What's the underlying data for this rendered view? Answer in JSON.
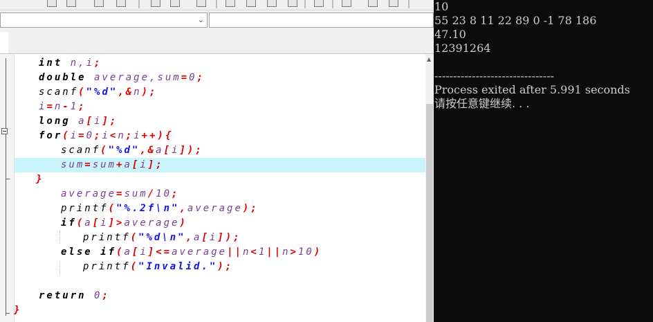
{
  "code_lines": [
    [
      {
        "t": "int",
        "c": "kw"
      },
      {
        "t": " n,i",
        "c": "id"
      },
      {
        "t": ";",
        "c": "op"
      }
    ],
    [
      {
        "t": "double",
        "c": "kw"
      },
      {
        "t": " average,sum",
        "c": "id"
      },
      {
        "t": "=",
        "c": "op"
      },
      {
        "t": "0",
        "c": "num"
      },
      {
        "t": ";",
        "c": "op"
      }
    ],
    [
      {
        "t": "scanf",
        "c": "fn"
      },
      {
        "t": "(",
        "c": "op"
      },
      {
        "t": "\"%d\"",
        "c": "str"
      },
      {
        "t": ",&",
        "c": "op"
      },
      {
        "t": "n",
        "c": "id"
      },
      {
        "t": ");",
        "c": "op"
      }
    ],
    [
      {
        "t": "i",
        "c": "id"
      },
      {
        "t": "=",
        "c": "op"
      },
      {
        "t": "n",
        "c": "id"
      },
      {
        "t": "-",
        "c": "op"
      },
      {
        "t": "1",
        "c": "num"
      },
      {
        "t": ";",
        "c": "op"
      }
    ],
    [
      {
        "t": "long",
        "c": "kw"
      },
      {
        "t": " a",
        "c": "id"
      },
      {
        "t": "[",
        "c": "op"
      },
      {
        "t": "i",
        "c": "id"
      },
      {
        "t": "];",
        "c": "op"
      }
    ],
    [
      {
        "t": "for",
        "c": "kw"
      },
      {
        "t": "(",
        "c": "op"
      },
      {
        "t": "i",
        "c": "id"
      },
      {
        "t": "=",
        "c": "op"
      },
      {
        "t": "0",
        "c": "num"
      },
      {
        "t": ";",
        "c": "op"
      },
      {
        "t": "i",
        "c": "id"
      },
      {
        "t": "<",
        "c": "op"
      },
      {
        "t": "n",
        "c": "id"
      },
      {
        "t": ";",
        "c": "op"
      },
      {
        "t": "i",
        "c": "id"
      },
      {
        "t": "++){",
        "c": "op"
      }
    ],
    [
      {
        "t": "scanf",
        "c": "fn"
      },
      {
        "t": "(",
        "c": "op"
      },
      {
        "t": "\"%d\"",
        "c": "str"
      },
      {
        "t": ",&",
        "c": "op"
      },
      {
        "t": "a",
        "c": "id"
      },
      {
        "t": "[",
        "c": "op"
      },
      {
        "t": "i",
        "c": "id"
      },
      {
        "t": "]);",
        "c": "op"
      }
    ],
    [
      {
        "t": "sum",
        "c": "id"
      },
      {
        "t": "=",
        "c": "op"
      },
      {
        "t": "sum",
        "c": "id"
      },
      {
        "t": "+",
        "c": "op"
      },
      {
        "t": "a",
        "c": "id"
      },
      {
        "t": "[",
        "c": "op"
      },
      {
        "t": "i",
        "c": "id"
      },
      {
        "t": "];",
        "c": "op"
      }
    ],
    [
      {
        "t": "}",
        "c": "op"
      }
    ],
    [
      {
        "t": "average",
        "c": "id"
      },
      {
        "t": "=",
        "c": "op"
      },
      {
        "t": "sum",
        "c": "id"
      },
      {
        "t": "/",
        "c": "op"
      },
      {
        "t": "10",
        "c": "num"
      },
      {
        "t": ";",
        "c": "op"
      }
    ],
    [
      {
        "t": "printf",
        "c": "fn"
      },
      {
        "t": "(",
        "c": "op"
      },
      {
        "t": "\"%.2f\\n\"",
        "c": "str"
      },
      {
        "t": ",",
        "c": "op"
      },
      {
        "t": "average",
        "c": "id"
      },
      {
        "t": ");",
        "c": "op"
      }
    ],
    [
      {
        "t": "if",
        "c": "kw"
      },
      {
        "t": "(",
        "c": "op"
      },
      {
        "t": "a",
        "c": "id"
      },
      {
        "t": "[",
        "c": "op"
      },
      {
        "t": "i",
        "c": "id"
      },
      {
        "t": "]>",
        "c": "op"
      },
      {
        "t": "average",
        "c": "id"
      },
      {
        "t": ")",
        "c": "op"
      }
    ],
    [
      {
        "t": "printf",
        "c": "fn"
      },
      {
        "t": "(",
        "c": "op"
      },
      {
        "t": "\"%d\\n\"",
        "c": "str"
      },
      {
        "t": ",",
        "c": "op"
      },
      {
        "t": "a",
        "c": "id"
      },
      {
        "t": "[",
        "c": "op"
      },
      {
        "t": "i",
        "c": "id"
      },
      {
        "t": "]);",
        "c": "op"
      }
    ],
    [
      {
        "t": "else if",
        "c": "kw"
      },
      {
        "t": "(",
        "c": "op"
      },
      {
        "t": "a",
        "c": "id"
      },
      {
        "t": "[",
        "c": "op"
      },
      {
        "t": "i",
        "c": "id"
      },
      {
        "t": "]<=",
        "c": "op"
      },
      {
        "t": "average",
        "c": "id"
      },
      {
        "t": "||",
        "c": "op"
      },
      {
        "t": "n",
        "c": "id"
      },
      {
        "t": "<",
        "c": "op"
      },
      {
        "t": "1",
        "c": "num"
      },
      {
        "t": "||",
        "c": "op"
      },
      {
        "t": "n",
        "c": "id"
      },
      {
        "t": ">",
        "c": "op"
      },
      {
        "t": "10",
        "c": "num"
      },
      {
        "t": ")",
        "c": "op"
      }
    ],
    [
      {
        "t": "printf",
        "c": "fn"
      },
      {
        "t": "(",
        "c": "op"
      },
      {
        "t": "\"Invalid.\"",
        "c": "str"
      },
      {
        "t": ");",
        "c": "op"
      }
    ],
    [],
    [
      {
        "t": "return",
        "c": "kw"
      },
      {
        "t": " 0",
        "c": "num"
      },
      {
        "t": ";",
        "c": "op"
      }
    ],
    [
      {
        "t": "}",
        "c": "op"
      }
    ]
  ],
  "console_lines": [
    "10",
    "55 23 8 11 22 89 0 -1 78 186",
    "47.10",
    "12391264",
    "",
    "--------------------------------",
    "Process exited after 5.991 seconds",
    "请按任意键继续. . ."
  ],
  "colors": {
    "keyword": "#000000",
    "operator": "#e00000",
    "string": "#1414e0",
    "identifier": "#7a3d8f",
    "highlight": "#c7f5fb",
    "console_bg": "#0c0c0c"
  }
}
